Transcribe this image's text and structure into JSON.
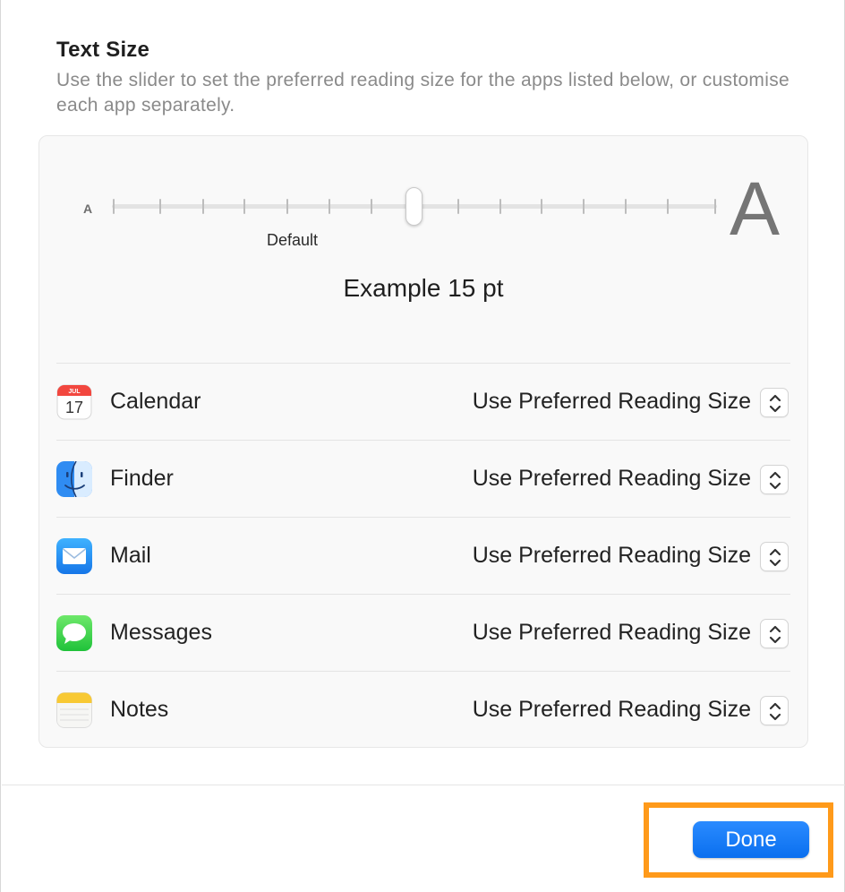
{
  "header": {
    "title": "Text Size",
    "description": "Use the slider to set the preferred reading size for the apps listed below, or customise each app separately."
  },
  "slider": {
    "small_label": "A",
    "large_label": "A",
    "default_label": "Default",
    "position_step": 7,
    "total_steps": 15
  },
  "example_text": "Example 15 pt",
  "apps": [
    {
      "name": "Calendar",
      "icon": "calendar-icon",
      "setting": "Use Preferred Reading Size",
      "calendar_month": "JUL",
      "calendar_day": "17"
    },
    {
      "name": "Finder",
      "icon": "finder-icon",
      "setting": "Use Preferred Reading Size"
    },
    {
      "name": "Mail",
      "icon": "mail-icon",
      "setting": "Use Preferred Reading Size"
    },
    {
      "name": "Messages",
      "icon": "messages-icon",
      "setting": "Use Preferred Reading Size"
    },
    {
      "name": "Notes",
      "icon": "notes-icon",
      "setting": "Use Preferred Reading Size"
    }
  ],
  "footer": {
    "done_label": "Done"
  },
  "colors": {
    "accent": "#0a6fef",
    "highlight": "#ff9a1a"
  }
}
